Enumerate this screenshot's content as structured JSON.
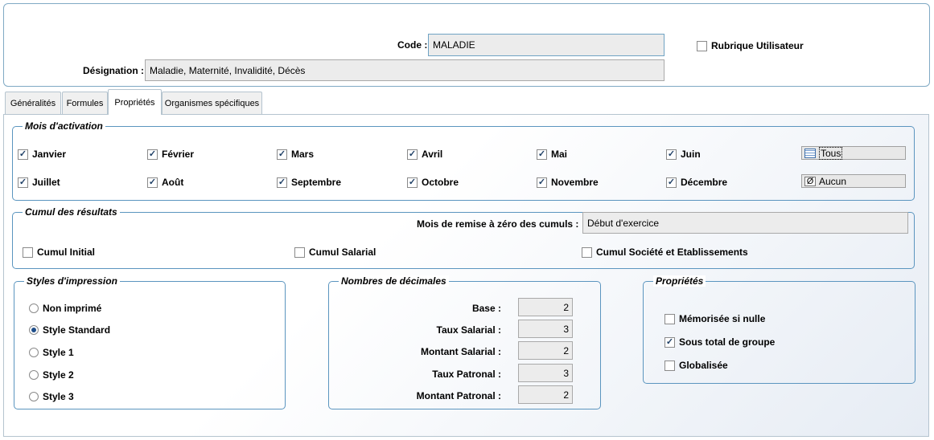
{
  "header": {
    "code_label": "Code :",
    "code_value": "MALADIE",
    "designation_label": "Désignation :",
    "designation_value": "Maladie, Maternité, Invalidité, Décès",
    "rubrique_label": "Rubrique Utilisateur",
    "rubrique_checked": false
  },
  "tabs": [
    {
      "label": "Généralités",
      "active": false
    },
    {
      "label": "Formules",
      "active": false
    },
    {
      "label": "Propriétés",
      "active": true
    },
    {
      "label": "Organismes spécifiques",
      "active": false
    }
  ],
  "mois": {
    "title": "Mois d'activation",
    "months": [
      {
        "label": "Janvier",
        "checked": true
      },
      {
        "label": "Février",
        "checked": true
      },
      {
        "label": "Mars",
        "checked": true
      },
      {
        "label": "Avril",
        "checked": true
      },
      {
        "label": "Mai",
        "checked": true
      },
      {
        "label": "Juin",
        "checked": true
      },
      {
        "label": "Juillet",
        "checked": true
      },
      {
        "label": "Août",
        "checked": true
      },
      {
        "label": "Septembre",
        "checked": true
      },
      {
        "label": "Octobre",
        "checked": true
      },
      {
        "label": "Novembre",
        "checked": true
      },
      {
        "label": "Décembre",
        "checked": true
      }
    ],
    "tous_label": "Tous",
    "aucun_label": "Aucun",
    "aucun_icon_glyph": "Ø"
  },
  "cumul": {
    "title": "Cumul des résultats",
    "remise_label": "Mois de remise à zéro des cumuls :",
    "remise_value": "Début d'exercice",
    "initial_label": "Cumul Initial",
    "salarial_label": "Cumul Salarial",
    "societe_label": "Cumul Société et Etablissements"
  },
  "styles": {
    "title": "Styles d'impression",
    "options": [
      {
        "label": "Non imprimé",
        "selected": false
      },
      {
        "label": "Style Standard",
        "selected": true
      },
      {
        "label": "Style 1",
        "selected": false
      },
      {
        "label": "Style 2",
        "selected": false
      },
      {
        "label": "Style 3",
        "selected": false
      }
    ]
  },
  "decimales": {
    "title": "Nombres de décimales",
    "rows": [
      {
        "label": "Base :",
        "value": "2"
      },
      {
        "label": "Taux Salarial :",
        "value": "3"
      },
      {
        "label": "Montant Salarial :",
        "value": "2"
      },
      {
        "label": "Taux Patronal :",
        "value": "3"
      },
      {
        "label": "Montant Patronal :",
        "value": "2"
      }
    ]
  },
  "proprietes": {
    "title": "Propriétés",
    "items": [
      {
        "label": "Mémorisée si nulle",
        "checked": false
      },
      {
        "label": "Sous total de groupe",
        "checked": true
      },
      {
        "label": "Globalisée",
        "checked": false
      }
    ]
  },
  "icons": {
    "check_glyph": "✓"
  },
  "colors": {
    "group_border": "#5b95bf",
    "field_bg": "#ececec"
  }
}
